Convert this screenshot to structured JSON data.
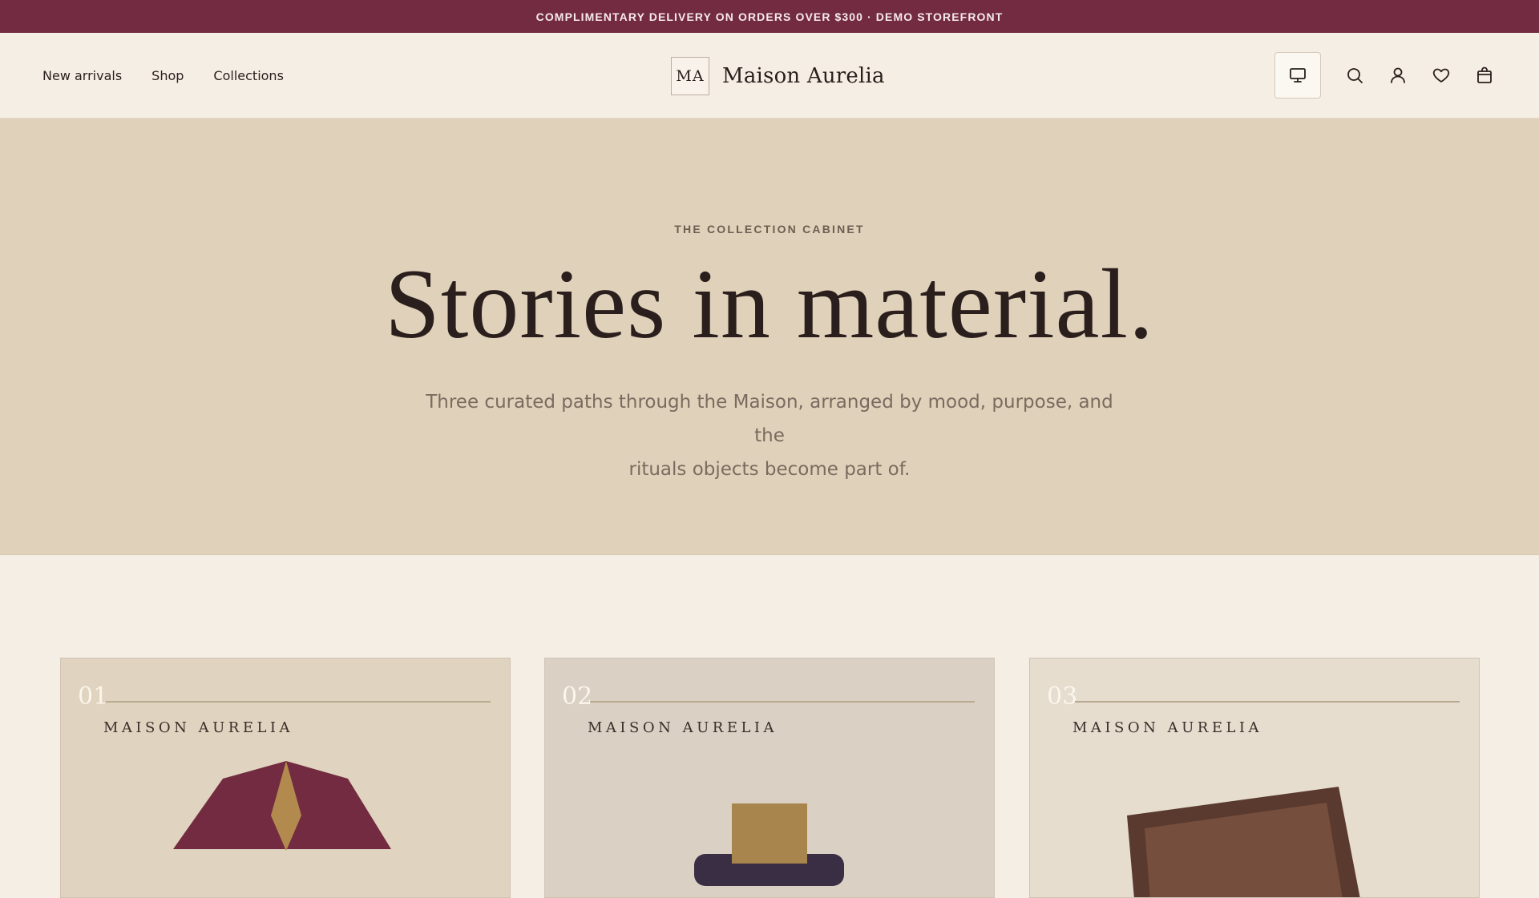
{
  "announcement": {
    "text": "COMPLIMENTARY DELIVERY ON ORDERS OVER $300 · DEMO STOREFRONT"
  },
  "header": {
    "nav": [
      {
        "label": "New arrivals"
      },
      {
        "label": "Shop"
      },
      {
        "label": "Collections"
      }
    ],
    "brand": {
      "monogram": "MA",
      "name": "Maison Aurelia"
    },
    "icons": [
      "display-icon",
      "search-icon",
      "account-icon",
      "wishlist-icon",
      "bag-icon"
    ]
  },
  "hero": {
    "eyebrow": "THE COLLECTION CABINET",
    "title": "Stories in material.",
    "subtitle_line1": "Three curated paths through the Maison, arranged by mood, purpose, and the",
    "subtitle_line2": "rituals objects become part of."
  },
  "cards": [
    {
      "number": "01",
      "label": "MAISON AURELIA",
      "background": "#E0D3BF",
      "accent": "#722B40"
    },
    {
      "number": "02",
      "label": "MAISON AURELIA",
      "background": "#DAD0C4",
      "accent": "#3A2E44"
    },
    {
      "number": "03",
      "label": "MAISON AURELIA",
      "background": "#E6DDCF",
      "accent": "#5A3A2E"
    }
  ],
  "colors": {
    "announcement_bg": "#722B40",
    "page_bg": "#F5EEE4",
    "hero_bg": "#E0D1BA",
    "text": "#2A1F1C"
  }
}
